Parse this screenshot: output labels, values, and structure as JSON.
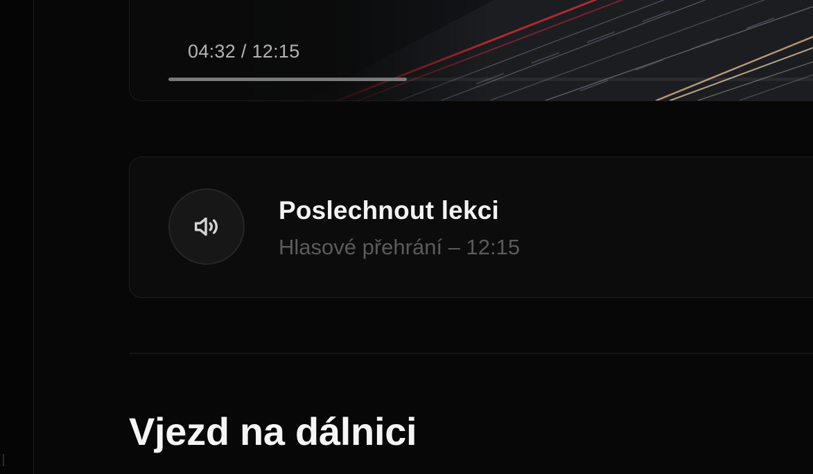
{
  "video": {
    "time_display": "04:32 / 12:15",
    "progress_fraction": 0.37
  },
  "audio_lesson": {
    "title": "Poslechnout lekci",
    "subtitle": "Hlasové přehrání – 12:15",
    "icon": "speaker-icon"
  },
  "section": {
    "heading": "Vjezd na dálnici"
  },
  "colors": {
    "background": "#070707",
    "card": "#0c0c0c",
    "title_text": "#f3f3f3",
    "muted_text": "#5b5b5b",
    "light_trail_red": "#d0303a"
  }
}
